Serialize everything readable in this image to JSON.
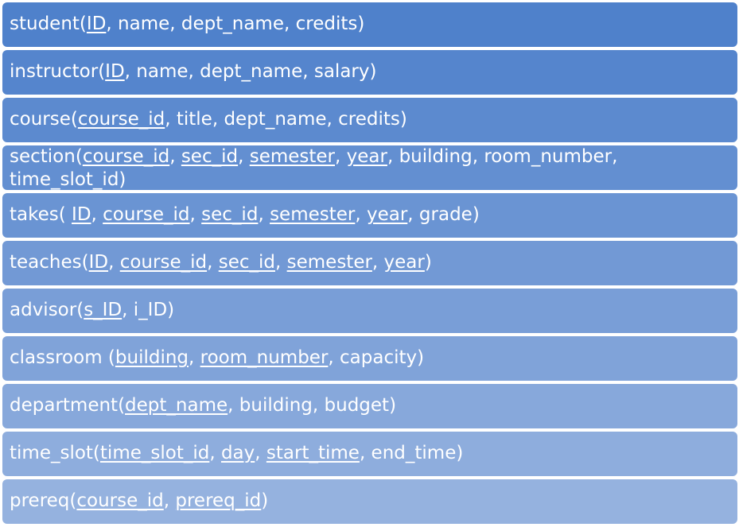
{
  "relations": [
    {
      "color": "#4F81CB",
      "wrap": false,
      "parts": [
        {
          "text": "student(",
          "key": false
        },
        {
          "text": "ID",
          "key": true
        },
        {
          "text": ", name, dept_name, credits)",
          "key": false
        }
      ]
    },
    {
      "color": "#5585CD",
      "wrap": false,
      "parts": [
        {
          "text": "instructor(",
          "key": false
        },
        {
          "text": "ID",
          "key": true
        },
        {
          "text": ", name, dept_name, salary)",
          "key": false
        }
      ]
    },
    {
      "color": "#5C8ACF",
      "wrap": false,
      "parts": [
        {
          "text": "course(",
          "key": false
        },
        {
          "text": "course_id",
          "key": true
        },
        {
          "text": ", title, dept_name, credits)",
          "key": false
        }
      ]
    },
    {
      "color": "#638FD1",
      "wrap": true,
      "parts": [
        {
          "text": "section(",
          "key": false
        },
        {
          "text": "course_id",
          "key": true
        },
        {
          "text": ", ",
          "key": false
        },
        {
          "text": "sec_id",
          "key": true
        },
        {
          "text": ", ",
          "key": false
        },
        {
          "text": "semester",
          "key": true
        },
        {
          "text": ", ",
          "key": false
        },
        {
          "text": "year",
          "key": true
        },
        {
          "text": ", building, room_number, time_slot_id)",
          "key": false
        }
      ]
    },
    {
      "color": "#6A94D3",
      "wrap": false,
      "parts": [
        {
          "text": "takes( ",
          "key": false
        },
        {
          "text": "ID",
          "key": true
        },
        {
          "text": ", ",
          "key": false
        },
        {
          "text": "course_id",
          "key": true
        },
        {
          "text": ", ",
          "key": false
        },
        {
          "text": "sec_id",
          "key": true
        },
        {
          "text": ", ",
          "key": false
        },
        {
          "text": "semester",
          "key": true
        },
        {
          "text": ", ",
          "key": false
        },
        {
          "text": "year",
          "key": true
        },
        {
          "text": ", grade)",
          "key": false
        }
      ]
    },
    {
      "color": "#7299D5",
      "wrap": false,
      "parts": [
        {
          "text": "teaches(",
          "key": false
        },
        {
          "text": "ID",
          "key": true
        },
        {
          "text": ", ",
          "key": false
        },
        {
          "text": "course_id",
          "key": true
        },
        {
          "text": ", ",
          "key": false
        },
        {
          "text": "sec_id",
          "key": true
        },
        {
          "text": ", ",
          "key": false
        },
        {
          "text": "semester",
          "key": true
        },
        {
          "text": ", ",
          "key": false
        },
        {
          "text": "year",
          "key": true
        },
        {
          "text": ")",
          "key": false
        }
      ]
    },
    {
      "color": "#799ED7",
      "wrap": false,
      "parts": [
        {
          "text": "advisor(",
          "key": false
        },
        {
          "text": "s_ID",
          "key": true
        },
        {
          "text": ", i_ID)",
          "key": false
        }
      ]
    },
    {
      "color": "#80A3D9",
      "wrap": false,
      "parts": [
        {
          "text": "classroom (",
          "key": false
        },
        {
          "text": "building",
          "key": true
        },
        {
          "text": ", ",
          "key": false
        },
        {
          "text": "room_number",
          "key": true
        },
        {
          "text": ", capacity)",
          "key": false
        }
      ]
    },
    {
      "color": "#87A8DB",
      "wrap": false,
      "parts": [
        {
          "text": "department(",
          "key": false
        },
        {
          "text": "dept_name",
          "key": true
        },
        {
          "text": ", building, budget)",
          "key": false
        }
      ]
    },
    {
      "color": "#8EADDD",
      "wrap": false,
      "parts": [
        {
          "text": "time_slot(",
          "key": false
        },
        {
          "text": "time_slot_id",
          "key": true
        },
        {
          "text": ", ",
          "key": false
        },
        {
          "text": "day",
          "key": true
        },
        {
          "text": ", ",
          "key": false
        },
        {
          "text": "start_time",
          "key": true
        },
        {
          "text": ", end_time)",
          "key": false
        }
      ]
    },
    {
      "color": "#95B2DF",
      "wrap": false,
      "parts": [
        {
          "text": "prereq(",
          "key": false
        },
        {
          "text": "course_id",
          "key": true
        },
        {
          "text": ", ",
          "key": false
        },
        {
          "text": "prereq_id",
          "key": true
        },
        {
          "text": ")",
          "key": false
        }
      ]
    }
  ]
}
